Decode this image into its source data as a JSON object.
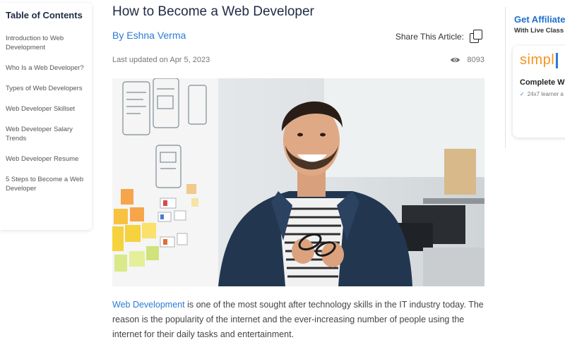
{
  "toc": {
    "title": "Table of Contents",
    "items": [
      "Introduction to Web Development",
      "Who Is a Web Developer?",
      "Types of Web Developers",
      "Web Developer Skillset",
      "Web Developer Salary Trends",
      "Web Developer Resume",
      "5 Steps to Become a Web Developer"
    ]
  },
  "article": {
    "title": "How to Become a Web Developer",
    "author": "By Eshna Verma",
    "share_label": "Share This Article:",
    "updated": "Last updated on Apr 5, 2023",
    "views": "8093",
    "intro_link": "Web Development",
    "intro_rest": " is one of the most sought after technology skills in the IT industry today. The reason is the popularity of the internet and the ever-increasing number of people using the internet for their daily tasks and entertainment."
  },
  "ad": {
    "headline": "Get Affiliate",
    "subline": "With Live Class",
    "logo_text": "simpl",
    "course_title": "Complete W",
    "feature": "24x7 learner a"
  },
  "colors": {
    "link": "#2a7bd5",
    "title": "#1f2a44",
    "brand_orange": "#f7931e"
  },
  "icons": [
    "copy-icon",
    "eye-icon",
    "check-icon"
  ]
}
